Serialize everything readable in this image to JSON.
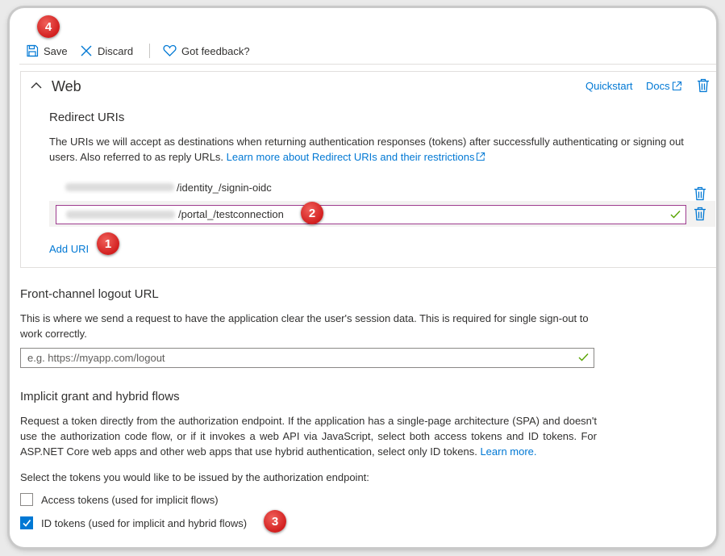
{
  "toolbar": {
    "save_label": "Save",
    "discard_label": "Discard",
    "feedback_label": "Got feedback?"
  },
  "web": {
    "title": "Web",
    "quickstart": "Quickstart",
    "docs": "Docs",
    "redirect_title": "Redirect URIs",
    "redirect_desc": "The URIs we will accept as destinations when returning authentication responses (tokens) after successfully authenticating or signing out users. Also referred to as reply URLs.",
    "redirect_link": "Learn more about Redirect URIs and their restrictions",
    "uris": [
      "/identity_/signin-oidc",
      "/portal_/testconnection"
    ],
    "add_uri": "Add URI"
  },
  "logout": {
    "title": "Front-channel logout URL",
    "desc": "This is where we send a request to have the application clear the user's session data. This is required for single sign-out to work correctly.",
    "placeholder": "e.g. https://myapp.com/logout"
  },
  "implicit": {
    "title": "Implicit grant and hybrid flows",
    "desc": "Request a token directly from the authorization endpoint. If the application has a single-page architecture (SPA) and doesn't use the authorization code flow, or if it invokes a web API via JavaScript, select both access tokens and ID tokens. For ASP.NET Core web apps and other web apps that use hybrid authentication, select only ID tokens.",
    "learn_more": "Learn more.",
    "select_label": "Select the tokens you would like to be issued by the authorization endpoint:",
    "access_tokens_label": "Access tokens (used for implicit flows)",
    "access_tokens_checked": false,
    "id_tokens_label": "ID tokens (used for implicit and hybrid flows)",
    "id_tokens_checked": true
  },
  "callouts": [
    "1",
    "2",
    "3",
    "4"
  ],
  "colors": {
    "accent": "#0078d4",
    "callout": "#d9241f",
    "input_focus": "#9e3c8f"
  }
}
